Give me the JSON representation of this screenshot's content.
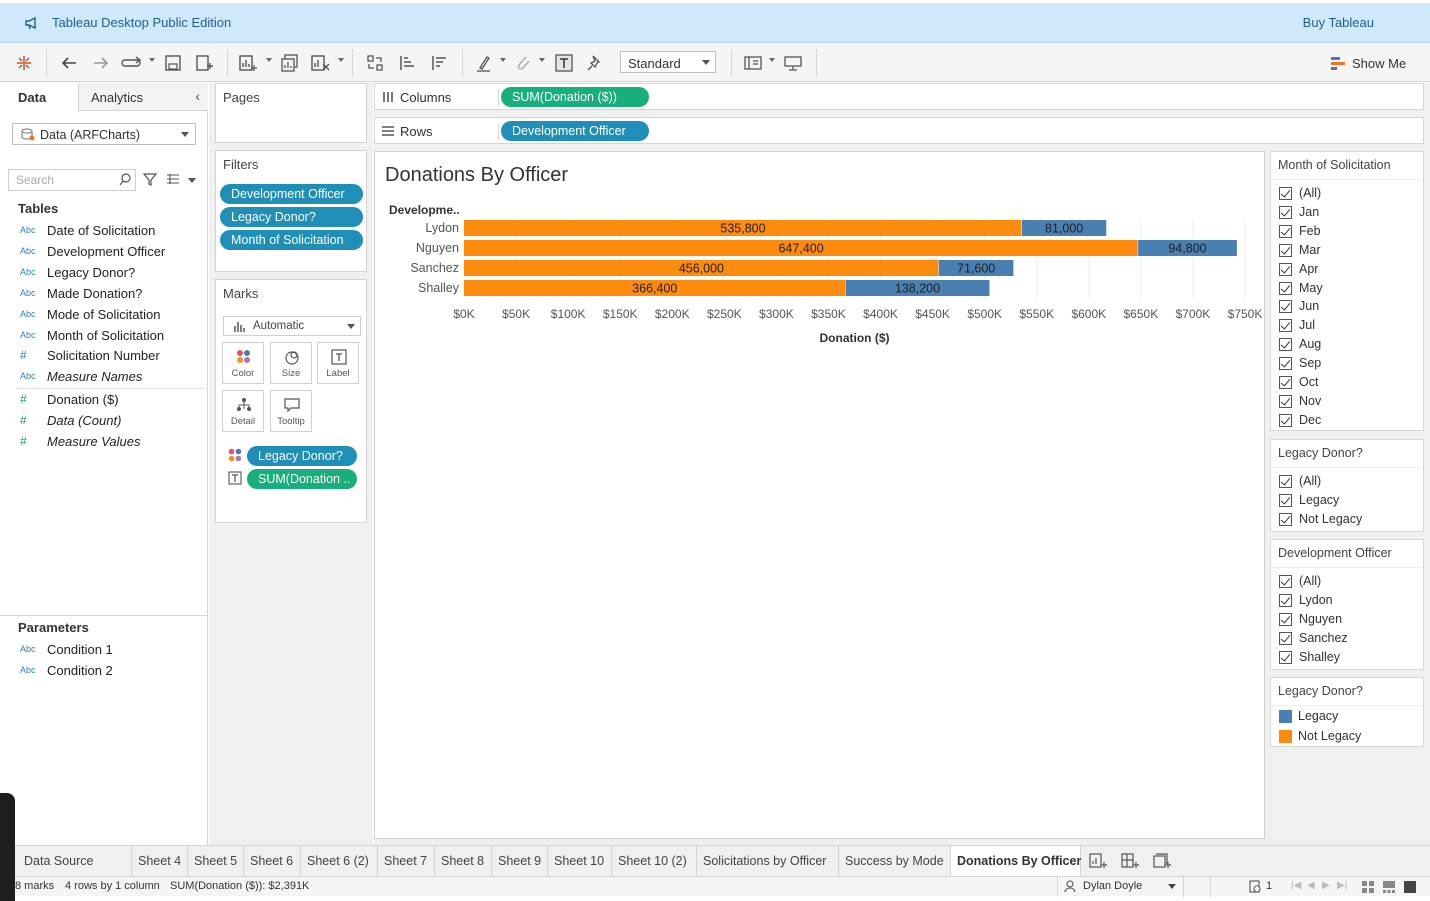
{
  "banner": {
    "title": "Tableau Desktop Public Edition",
    "buy": "Buy Tableau"
  },
  "toolbar": {
    "fit_mode": "Standard",
    "show_me": "Show Me"
  },
  "left_pane": {
    "tabs": {
      "data": "Data",
      "analytics": "Analytics"
    },
    "datasource": "Data (ARFCharts)",
    "search_placeholder": "Search",
    "tables_heading": "Tables",
    "dimensions": [
      {
        "type": "Abc",
        "name": "Date of Solicitation"
      },
      {
        "type": "Abc",
        "name": "Development Officer"
      },
      {
        "type": "Abc",
        "name": "Legacy Donor?"
      },
      {
        "type": "Abc",
        "name": "Made Donation?"
      },
      {
        "type": "Abc",
        "name": "Mode of Solicitation"
      },
      {
        "type": "Abc",
        "name": "Month of Solicitation"
      },
      {
        "type": "#",
        "name": "Solicitation Number"
      },
      {
        "type": "Abc",
        "name": "Measure Names"
      }
    ],
    "measures": [
      {
        "type": "#",
        "name": "Donation ($)"
      },
      {
        "type": "#",
        "name": "Data (Count)"
      },
      {
        "type": "#",
        "name": "Measure Values"
      }
    ],
    "parameters_heading": "Parameters",
    "parameters": [
      {
        "type": "Abc",
        "name": "Condition 1"
      },
      {
        "type": "Abc",
        "name": "Condition 2"
      }
    ]
  },
  "pages": {
    "title": "Pages"
  },
  "filters": {
    "title": "Filters",
    "pills": [
      "Development Officer",
      "Legacy Donor?",
      "Month of Solicitation"
    ]
  },
  "marks": {
    "title": "Marks",
    "type": "Automatic",
    "buttons": {
      "color": "Color",
      "size": "Size",
      "label": "Label",
      "detail": "Detail",
      "tooltip": "Tooltip"
    },
    "pills": [
      "Legacy Donor?",
      "SUM(Donation .."
    ]
  },
  "shelves": {
    "columns_label": "Columns",
    "columns_pill": "SUM(Donation ($))",
    "rows_label": "Rows",
    "rows_pill": "Development Officer"
  },
  "colors": {
    "legacy": "#4a7fb1",
    "not_legacy": "#fd8b0e",
    "pill_blue": "#1f8fb8",
    "pill_green": "#17b07b"
  },
  "chart_data": {
    "type": "bar",
    "orientation": "horizontal",
    "stacked": true,
    "title": "Donations By Officer",
    "row_header": "Developme..",
    "xlabel": "Donation ($)",
    "categories": [
      "Lydon",
      "Nguyen",
      "Sanchez",
      "Shalley"
    ],
    "series": [
      {
        "name": "Not Legacy",
        "color": "#fd8b0e",
        "values": [
          535800,
          647400,
          456000,
          366400
        ],
        "labels": [
          "535,800",
          "647,400",
          "456,000",
          "366,400"
        ]
      },
      {
        "name": "Legacy",
        "color": "#4a7fb1",
        "values": [
          81000,
          94800,
          71600,
          138200
        ],
        "labels": [
          "81,000",
          "94,800",
          "71,600",
          "138,200"
        ]
      }
    ],
    "xlim": [
      0,
      750000
    ],
    "xticks": [
      "$0K",
      "$50K",
      "$100K",
      "$150K",
      "$200K",
      "$250K",
      "$300K",
      "$350K",
      "$400K",
      "$450K",
      "$500K",
      "$550K",
      "$600K",
      "$650K",
      "$700K",
      "$750K"
    ],
    "xtick_values": [
      0,
      50000,
      100000,
      150000,
      200000,
      250000,
      300000,
      350000,
      400000,
      450000,
      500000,
      550000,
      600000,
      650000,
      700000,
      750000
    ],
    "grid": true
  },
  "filter_cards": {
    "month": {
      "title": "Month of Solicitation",
      "items": [
        "(All)",
        "Jan",
        "Feb",
        "Mar",
        "Apr",
        "May",
        "Jun",
        "Jul",
        "Aug",
        "Sep",
        "Oct",
        "Nov",
        "Dec"
      ]
    },
    "legacy": {
      "title": "Legacy Donor?",
      "items": [
        "(All)",
        "Legacy",
        "Not Legacy"
      ]
    },
    "officer": {
      "title": "Development Officer",
      "items": [
        "(All)",
        "Lydon",
        "Nguyen",
        "Sanchez",
        "Shalley"
      ]
    }
  },
  "legend": {
    "title": "Legacy Donor?",
    "items": [
      {
        "label": "Legacy",
        "color": "#4a7fb1"
      },
      {
        "label": "Not Legacy",
        "color": "#fd8b0e"
      }
    ]
  },
  "sheet_tabs": [
    "Data Source",
    "Sheet 4",
    "Sheet 5",
    "Sheet 6",
    "Sheet 6 (2)",
    "Sheet 7",
    "Sheet 8",
    "Sheet 9",
    "Sheet 10",
    "Sheet 10 (2)",
    "Solicitations by Officer",
    "Success by Mode",
    "Donations By Officer"
  ],
  "active_tab": "Donations By Officer",
  "status_bar": {
    "marks": "8 marks",
    "rows_cols": "4 rows by 1 column",
    "sum": "SUM(Donation ($)): $2,391K",
    "user": "Dylan Doyle",
    "sheet_count": "1"
  }
}
